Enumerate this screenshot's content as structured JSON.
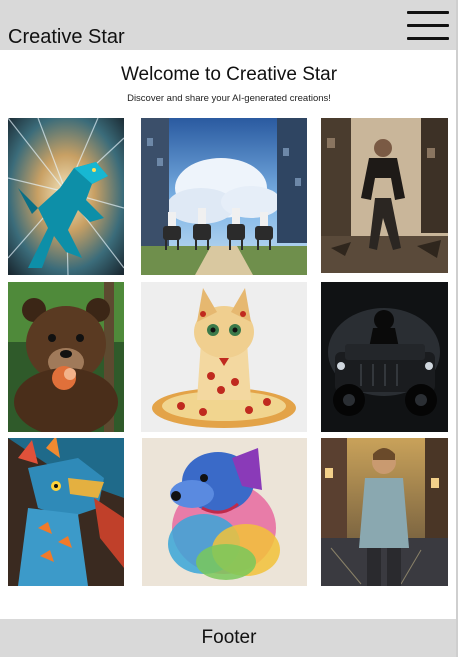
{
  "header": {
    "brand": "Creative Star",
    "menu_icon": "hamburger-menu-icon"
  },
  "hero": {
    "title": "Welcome to Creative Star",
    "subtitle": "Discover and share your AI-generated creations!"
  },
  "gallery": {
    "images": [
      {
        "subject": "blue dragon bursting through speed lines"
      },
      {
        "subject": "four riders on horseback in a ruined anime city"
      },
      {
        "subject": "man running down a war-torn street"
      },
      {
        "subject": "brown bear eating in a forest"
      },
      {
        "subject": "cat sitting on a pizza made of pizza"
      },
      {
        "subject": "dark figure on a black off-road jeep"
      },
      {
        "subject": "colorful scaled dragon portrait"
      },
      {
        "subject": "rainbow smoke dog"
      },
      {
        "subject": "boy standing on a rainy city street"
      }
    ]
  },
  "footer": {
    "label": "Footer"
  }
}
